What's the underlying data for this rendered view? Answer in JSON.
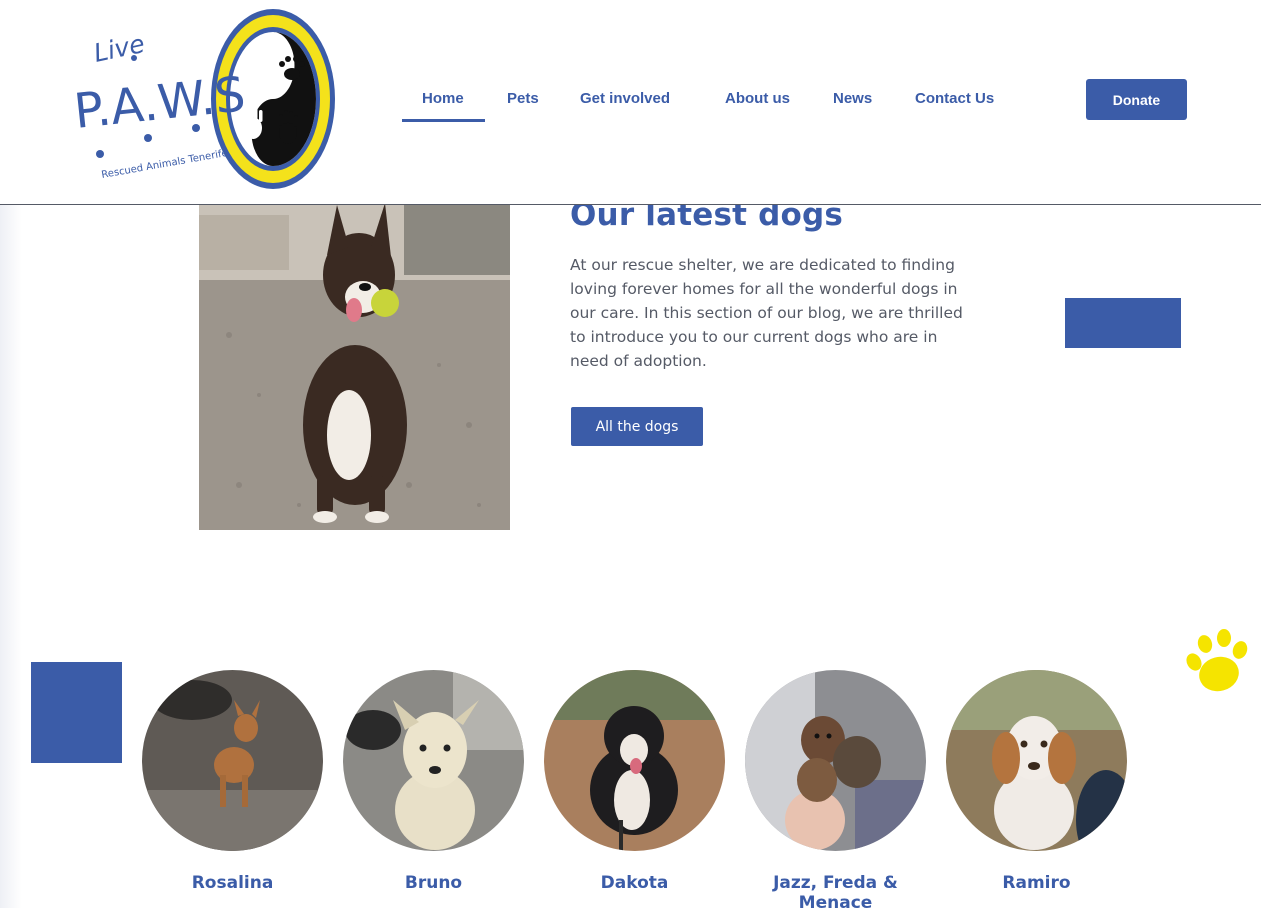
{
  "header": {
    "logo": {
      "word_top": "Live",
      "letters": "P.A.W.S",
      "tagline": "Rescued Animals Tenerife"
    },
    "nav": [
      {
        "label": "Home",
        "active": true
      },
      {
        "label": "Pets",
        "active": false
      },
      {
        "label": "Get involved",
        "active": false
      },
      {
        "label": "About us",
        "active": false
      },
      {
        "label": "News",
        "active": false
      },
      {
        "label": "Contact Us",
        "active": false
      }
    ],
    "donate_label": "Donate"
  },
  "latest": {
    "title": "Our latest dogs",
    "text": "At our rescue shelter, we are dedicated to finding loving forever homes for all the wonderful dogs in our care. In this section of our blog, we are thrilled to introduce you to our current dogs who are in need of adoption.",
    "button_label": "All the dogs"
  },
  "dogs": [
    {
      "name": "Rosalina"
    },
    {
      "name": "Bruno"
    },
    {
      "name": "Dakota"
    },
    {
      "name": "Jazz, Freda & Menace"
    },
    {
      "name": "Ramiro"
    }
  ],
  "colors": {
    "brand_blue": "#3b5ca8",
    "logo_yellow": "#f4e21b",
    "paw_yellow": "#f5e400",
    "body_text": "#555a66"
  },
  "icons": {
    "paw": "paw-icon"
  }
}
